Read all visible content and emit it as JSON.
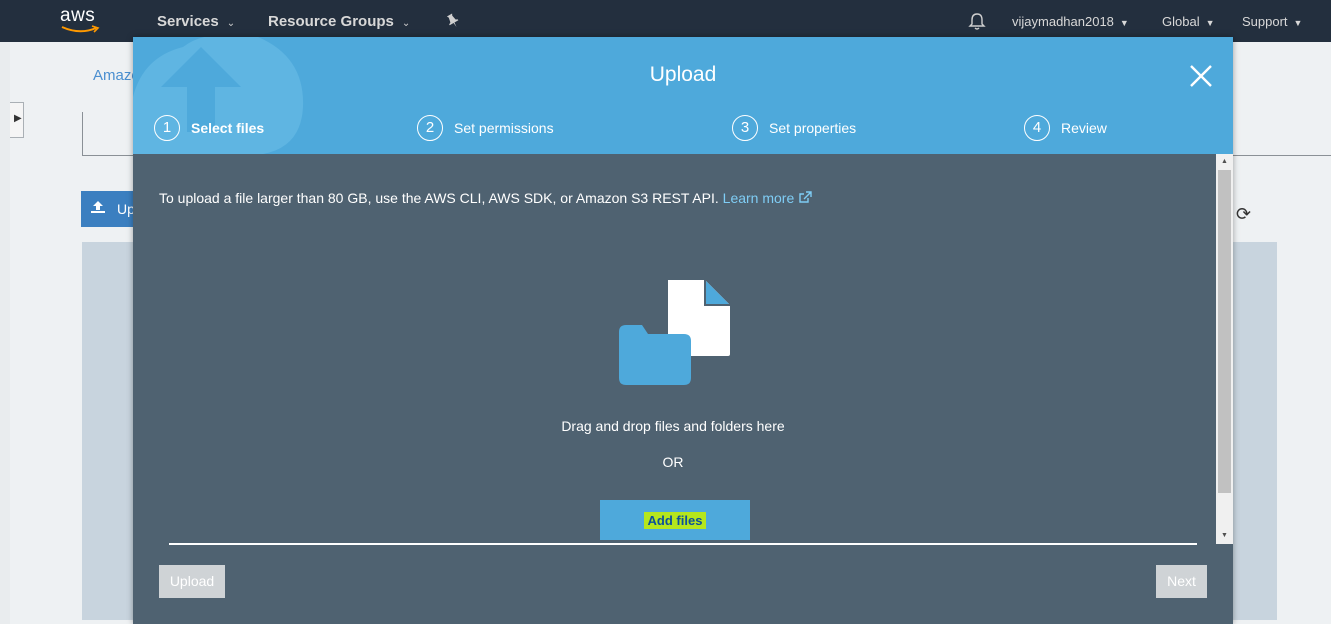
{
  "topnav": {
    "logo_text": "aws",
    "services": "Services",
    "resource_groups": "Resource Groups",
    "username": "vijaymadhan2018",
    "region": "Global",
    "support": "Support"
  },
  "background": {
    "breadcrumb": "Amazo",
    "upload_button": "Up"
  },
  "modal": {
    "title": "Upload",
    "steps": [
      {
        "number": "1",
        "label": "Select files",
        "active": true
      },
      {
        "number": "2",
        "label": "Set permissions",
        "active": false
      },
      {
        "number": "3",
        "label": "Set properties",
        "active": false
      },
      {
        "number": "4",
        "label": "Review",
        "active": false
      }
    ],
    "notice_text": "To upload a file larger than 80 GB, use the AWS CLI, AWS SDK, or Amazon S3 REST API.",
    "learn_more": "Learn more",
    "drop_text": "Drag and drop files and folders here",
    "or_text": "OR",
    "add_files": "Add files",
    "upload_button": "Upload",
    "next_button": "Next"
  },
  "colors": {
    "nav_bg": "#232f3e",
    "header_blue": "#4ea9db",
    "modal_body": "#4f6271",
    "link": "#7fcdf5",
    "highlight": "#b5e61d"
  }
}
